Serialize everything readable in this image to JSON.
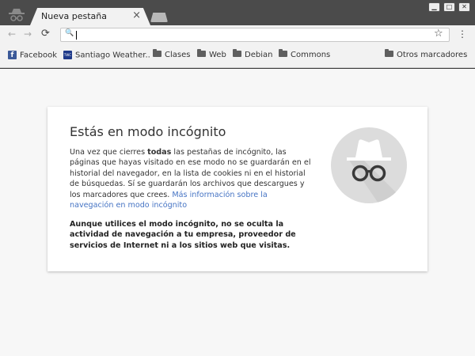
{
  "tab": {
    "title": "Nueva pestaña",
    "close": "×"
  },
  "window": {
    "minimize": "▁",
    "maximize": "□",
    "close": "✕"
  },
  "toolbar": {
    "back": "←",
    "forward": "→",
    "reload": "⟳",
    "search_icon": "🔍",
    "address_value": "",
    "star": "☆",
    "menu": "⋮"
  },
  "bookmarks": {
    "items": [
      {
        "label": "Facebook",
        "icon": "facebook-icon"
      },
      {
        "label": "Santiago Weather..",
        "icon": "twc-icon"
      },
      {
        "label": "Clases",
        "icon": "folder-icon"
      },
      {
        "label": "Web",
        "icon": "folder-icon"
      },
      {
        "label": "Debian",
        "icon": "folder-icon"
      },
      {
        "label": "Commons",
        "icon": "folder-icon"
      }
    ],
    "other": "Otros marcadores",
    "twc_icon_text": "TWC",
    "fb_icon_text": "f"
  },
  "incognito": {
    "title": "Estás en modo incógnito",
    "p1_a": "Una vez que cierres ",
    "p1_b": "todas",
    "p1_c": " las pestañas de incógnito, las páginas que hayas visitado en ese modo no se guardarán en el historial del navegador, en la lista de cookies ni en el historial de búsquedas. Sí se guardarán los archivos que descargues y los marcadores que crees. ",
    "p1_link": "Más información sobre la navegación en modo incógnito",
    "p2": "Aunque utilices el modo incógnito, no se oculta la actividad de navegación a tu empresa, proveedor de servicios de Internet ni a los sitios web que visitas."
  },
  "colors": {
    "link": "#4674c4",
    "frame": "#4b4b4b",
    "tab": "#f2f2f2",
    "page": "#f7f7f7"
  }
}
